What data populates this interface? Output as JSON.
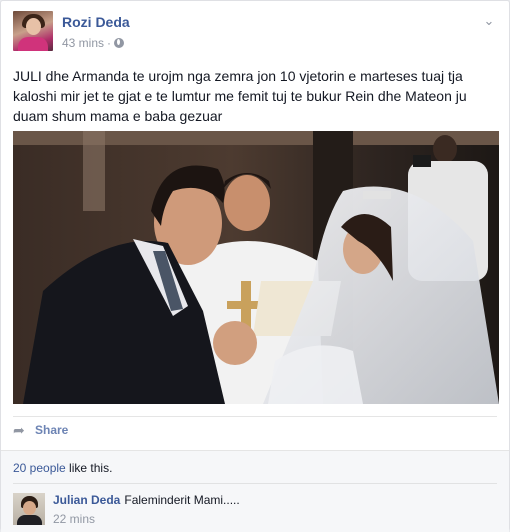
{
  "post": {
    "author_name": "Rozi Deda",
    "time": "43 mins",
    "separator": "·",
    "text": "JULI dhe Armanda te urojm nga zemra jon 10 vjetorin e marteses tuaj tja kaloshi mir jet te gjat e te lumtur me femit tuj te bukur Rein dhe Mateon ju duam shum mama e baba gezuar",
    "photo_icon": "wedding-photo",
    "options_icon": "chevron-down-icon",
    "privacy_icon": "globe-icon"
  },
  "actions": {
    "share_label": "Share",
    "share_icon": "share-arrow-icon"
  },
  "likes": {
    "count_text": "20 people",
    "suffix": " like this."
  },
  "comment": {
    "author": "Julian Deda",
    "text": "Faleminderit Mami.....",
    "time": "22 mins"
  },
  "colors": {
    "link": "#3b5998",
    "muted": "#9197a3",
    "ufi_background": "#f6f7f9"
  }
}
